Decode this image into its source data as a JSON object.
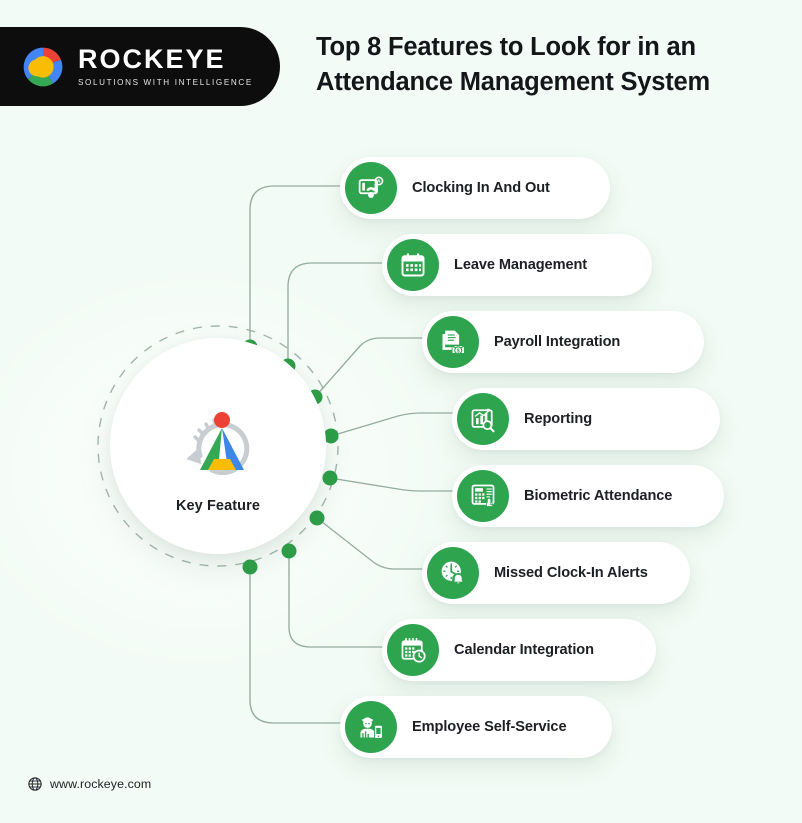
{
  "brand": {
    "name": "ROCKEYE",
    "tagline": "SOLUTIONS WITH INTELLIGENCE",
    "logo_icon": "swirl-logo-icon",
    "colors": {
      "pill_bg": "#0d0d0d",
      "swirl_red": "#ea4335",
      "swirl_blue": "#4285f4",
      "swirl_yellow": "#fbbc05",
      "swirl_green": "#34a853"
    }
  },
  "header": {
    "title": "Top 8 Features to Look for in an Attendance Management System"
  },
  "hub": {
    "label": "Key Feature",
    "icon": "person-triangle-refresh-icon"
  },
  "theme": {
    "background": "#f2fbf5",
    "accent_green": "#2ea44f",
    "node_green": "#2d9e47",
    "line_gray": "#8fa99a",
    "text_dark": "#1d1f24"
  },
  "features": [
    {
      "label": "Clocking In And Out",
      "icon": "fingerprint-scanner-icon"
    },
    {
      "label": "Leave Management",
      "icon": "calendar-icon"
    },
    {
      "label": "Payroll Integration",
      "icon": "payroll-document-icon"
    },
    {
      "label": "Reporting",
      "icon": "bar-chart-magnifier-icon"
    },
    {
      "label": "Biometric Attendance",
      "icon": "biometric-keypad-icon"
    },
    {
      "label": "Missed Clock-In Alerts",
      "icon": "clock-bell-icon"
    },
    {
      "label": "Calendar Integration",
      "icon": "calendar-clock-icon"
    },
    {
      "label": "Employee Self-Service",
      "icon": "employee-mobile-icon"
    }
  ],
  "footer": {
    "url": "www.rockeye.com",
    "icon": "globe-icon"
  }
}
